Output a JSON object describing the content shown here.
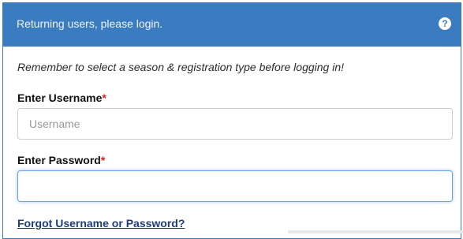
{
  "header": {
    "title": "Returning users, please login.",
    "help_icon": "question-circle-icon"
  },
  "reminder": "Remember to select a season & registration type before logging in!",
  "username": {
    "label": "Enter Username",
    "required_marker": "*",
    "placeholder": "Username",
    "value": ""
  },
  "password": {
    "label": "Enter Password",
    "required_marker": "*",
    "placeholder": "",
    "value": ""
  },
  "forgot_link": "Forgot Username or Password?",
  "colors": {
    "header_bg": "#3b7bbf",
    "required": "#d32020",
    "link": "#1f3c7a"
  }
}
